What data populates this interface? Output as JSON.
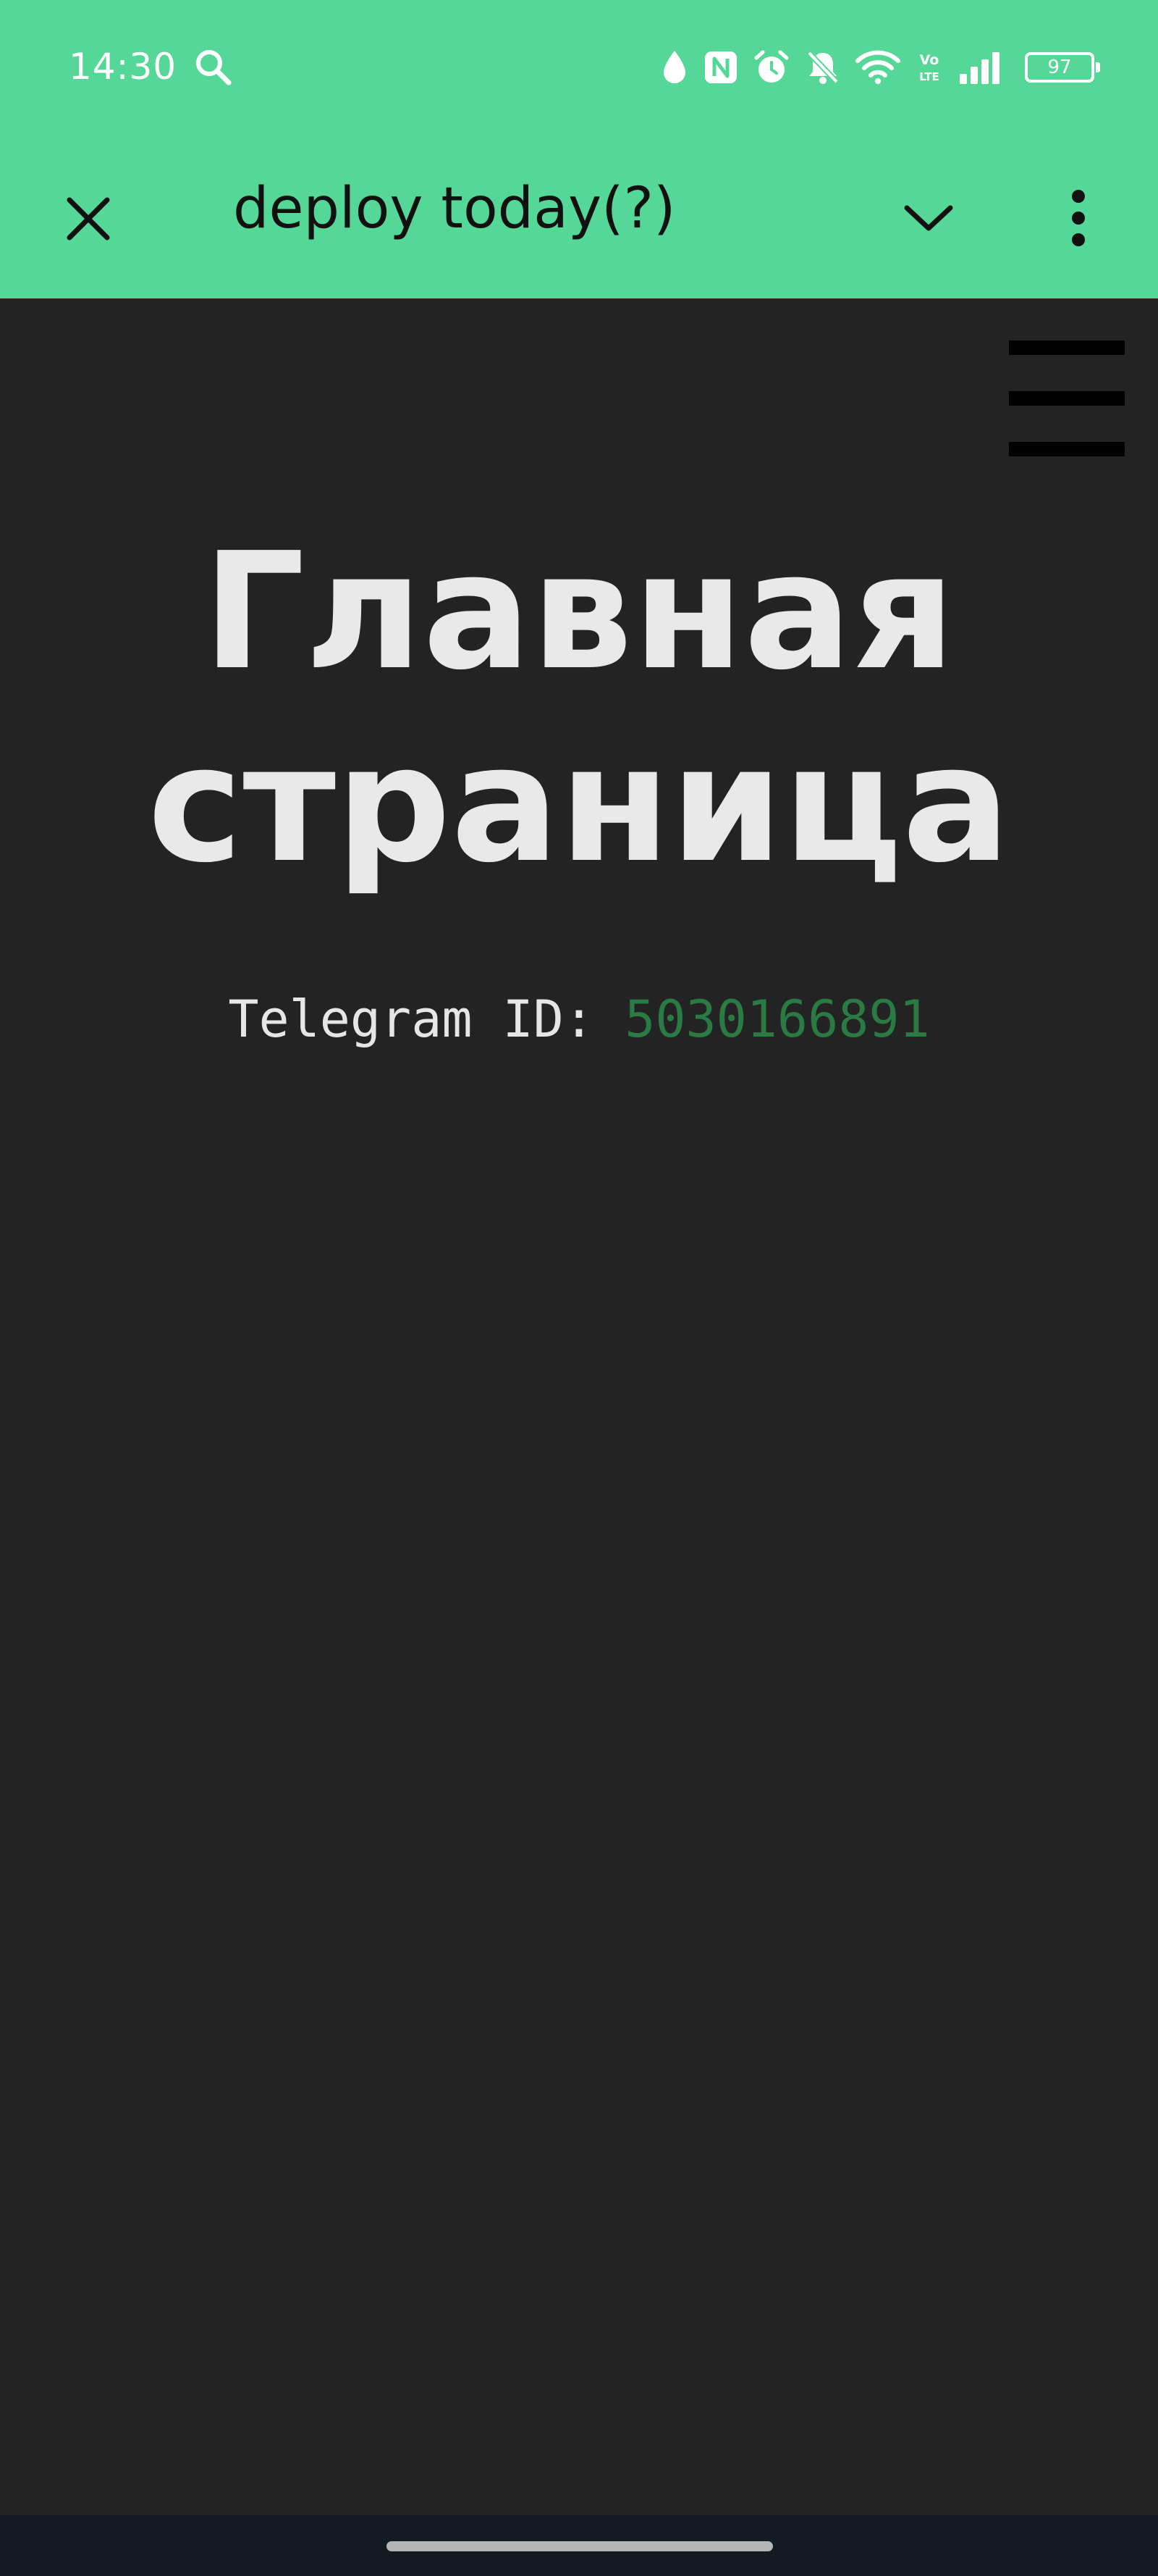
{
  "status_bar": {
    "time": "14:30",
    "battery_level": "97",
    "icons": [
      "search-icon",
      "water-drop-icon",
      "nfc-icon",
      "alarm-icon",
      "bell-muted-icon",
      "wifi-icon",
      "volte-icon",
      "signal-icon",
      "battery-icon"
    ]
  },
  "app_bar": {
    "title": "deploy today(?)",
    "icons": [
      "close-icon",
      "chevron-down-icon",
      "more-vertical-icon"
    ]
  },
  "page": {
    "title_line1": "Главная",
    "title_line2": "страница",
    "telegram_label": "Telegram ID: ",
    "telegram_id": "5030166891"
  },
  "colors": {
    "app_bar_bg": "#55d897",
    "content_bg": "#232323",
    "title_text": "#e9e9e9",
    "id_accent": "#2a7a43",
    "nav_bar_bg": "#141a22"
  }
}
